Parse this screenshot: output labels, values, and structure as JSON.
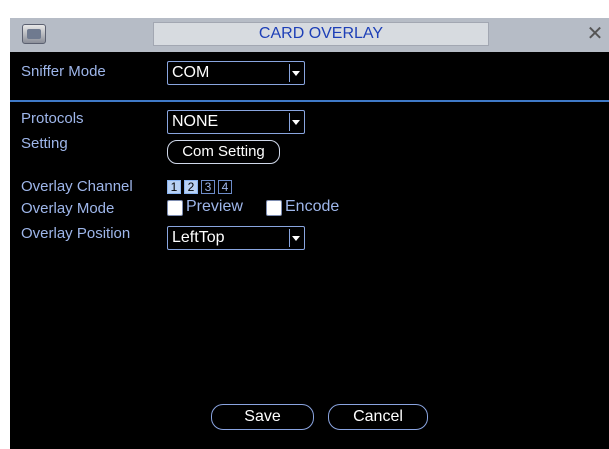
{
  "window": {
    "title": "CARD OVERLAY",
    "close_icon": "close-icon"
  },
  "form": {
    "sniffer_mode": {
      "label": "Sniffer Mode",
      "value": "COM"
    },
    "protocols": {
      "label": "Protocols",
      "value": "NONE"
    },
    "setting": {
      "label": "Setting",
      "button": "Com Setting"
    },
    "overlay_channel": {
      "label": "Overlay Channel",
      "channels": [
        "1",
        "2",
        "3",
        "4"
      ],
      "selected": [
        "1",
        "2"
      ]
    },
    "overlay_mode": {
      "label": "Overlay Mode",
      "preview": "Preview",
      "encode": "Encode"
    },
    "overlay_position": {
      "label": "Overlay Position",
      "value": "LeftTop"
    }
  },
  "buttons": {
    "save": "Save",
    "cancel": "Cancel"
  },
  "colors": {
    "background": "#000000",
    "label": "#9eb6ea",
    "title_text": "#1d3fb7",
    "separator": "#3f79c7"
  }
}
